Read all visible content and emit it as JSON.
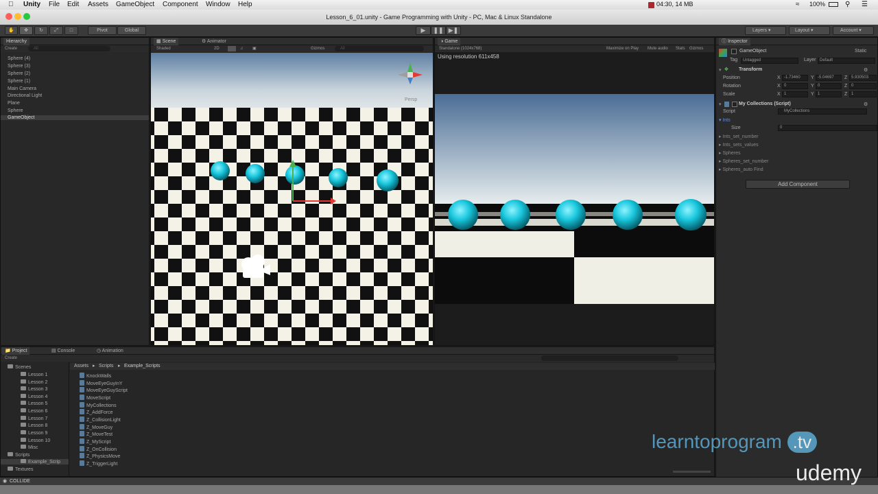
{
  "mac_menu": {
    "app": "Unity",
    "items": [
      "File",
      "Edit",
      "Assets",
      "GameObject",
      "Component",
      "Window",
      "Help"
    ],
    "status": "04:30, 14 MB",
    "battery": "100%"
  },
  "window_title": "Lesson_6_01.unity - Game Programming with Unity - PC, Mac & Linux Standalone",
  "toolbar": {
    "pivot": "Pivot",
    "global": "Global",
    "layers": "Layers",
    "layout": "Layout",
    "account": "Account"
  },
  "hierarchy": {
    "tab": "Hierarchy",
    "create": "Create",
    "search_placeholder": "All",
    "items": [
      "Sphere (4)",
      "Sphere (3)",
      "Sphere (2)",
      "Sphere (1)",
      "Main Camera",
      "Directional Light",
      "Plane",
      "Sphere",
      "GameObject"
    ],
    "selected": "GameObject"
  },
  "scene": {
    "tab": "Scene",
    "tab2": "Animator",
    "shaded": "Shaded",
    "mode_2d": "2D",
    "gizmos": "Gizmos",
    "search_placeholder": "All",
    "persp": "Persp"
  },
  "game": {
    "tab": "Game",
    "aspect": "Standalone (1024x768)",
    "maximize": "Maximize on Play",
    "mute": "Mute audio",
    "stats": "Stats",
    "gizmos": "Gizmos",
    "resolution": "Using resolution 611x458"
  },
  "inspector": {
    "tab": "Inspector",
    "object_name": "GameObject",
    "static": "Static",
    "tag_label": "Tag",
    "tag_value": "Untagged",
    "layer_label": "Layer",
    "layer_value": "Default",
    "transform": "Transform",
    "position_label": "Position",
    "pos_x": "-1.73460",
    "pos_y": "-5.04697",
    "pos_z": "5.930503",
    "rotation_label": "Rotation",
    "rot_x": "0",
    "rot_y": "0",
    "rot_z": "0",
    "scale_label": "Scale",
    "scale_x": "1",
    "scale_y": "1",
    "scale_z": "1",
    "component": "My Collections (Script)",
    "script_label": "Script",
    "script_value": "MyCollections",
    "ints": "Ints",
    "size_label": "Size",
    "size_value": "0",
    "fields": [
      "Ints_set_number",
      "Ints_sets_values",
      "Spheres",
      "Spheres_set_number",
      "Spheres_auto Find"
    ],
    "add_component": "Add Component",
    "axis_x": "X",
    "axis_y": "Y",
    "axis_z": "Z"
  },
  "project": {
    "tab": "Project",
    "tab2": "Console",
    "tab3": "Animation",
    "create": "Create",
    "tree": [
      "Scenes",
      "Lesson 1",
      "Lesson 2",
      "Lesson 3",
      "Lesson 4",
      "Lesson 5",
      "Lesson 6",
      "Lesson 7",
      "Lesson 8",
      "Lesson 9",
      "Lesson 10",
      "Misc",
      "Scripts",
      "Example_Scrip",
      "Textures"
    ],
    "breadcrumb": [
      "Assets",
      "Scripts",
      "Example_Scripts"
    ],
    "assets": [
      "KnockWalls",
      "MoveEyeGuyInY",
      "MoveEyeGuyScript",
      "MoveScript",
      "MyCollections",
      "Z_AddForce",
      "Z_CollisionLight",
      "Z_MoveGuy",
      "Z_MoveTest",
      "Z_MyScript",
      "Z_OnCollision",
      "Z_PhysicsMove",
      "Z_TriggerLight"
    ]
  },
  "status_bar": "COLLIDE",
  "watermark": {
    "brand1": "learntoprogram",
    "brand1_tv": ".tv",
    "brand2": "udemy"
  }
}
